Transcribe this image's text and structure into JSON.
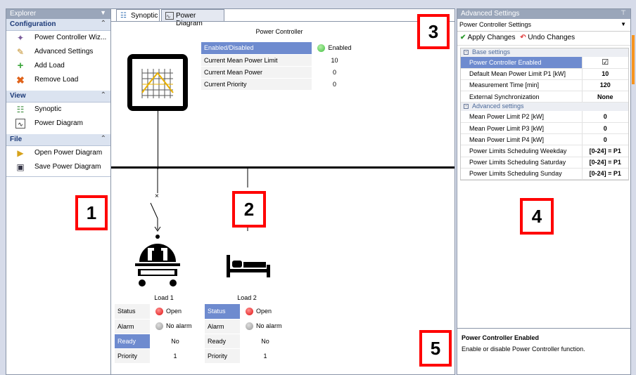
{
  "explorer": {
    "title": "Explorer",
    "sections": [
      {
        "label": "Configuration",
        "items": [
          {
            "label": "Power Controller Wiz...",
            "icon": "wand-icon"
          },
          {
            "label": "Advanced Settings",
            "icon": "edit-icon"
          },
          {
            "label": "Add Load",
            "icon": "add-icon"
          },
          {
            "label": "Remove Load",
            "icon": "remove-icon"
          }
        ]
      },
      {
        "label": "View",
        "items": [
          {
            "label": "Synoptic",
            "icon": "synoptic-icon"
          },
          {
            "label": "Power Diagram",
            "icon": "diagram-icon"
          }
        ]
      },
      {
        "label": "File",
        "items": [
          {
            "label": "Open Power Diagram",
            "icon": "open-folder-icon"
          },
          {
            "label": "Save Power Diagram",
            "icon": "save-icon"
          }
        ]
      }
    ]
  },
  "tabs": {
    "synoptic": "Synoptic",
    "power_diagram": "Power Diagram"
  },
  "controller": {
    "title": "Power Controller",
    "rows": [
      {
        "label": "Enabled/Disabled",
        "value": "Enabled"
      },
      {
        "label": "Current Mean Power Limit",
        "value": "10"
      },
      {
        "label": "Current Mean Power",
        "value": "0"
      },
      {
        "label": "Current Priority",
        "value": "0"
      }
    ]
  },
  "loads": [
    {
      "name": "Load 1",
      "rows": [
        {
          "label": "Status",
          "value": "Open"
        },
        {
          "label": "Alarm",
          "value": "No alarm"
        },
        {
          "label": "Ready",
          "value": "No"
        },
        {
          "label": "Priority",
          "value": "1"
        }
      ]
    },
    {
      "name": "Load 2",
      "rows": [
        {
          "label": "Status",
          "value": "Open"
        },
        {
          "label": "Alarm",
          "value": "No alarm"
        },
        {
          "label": "Ready",
          "value": "No"
        },
        {
          "label": "Priority",
          "value": "1"
        }
      ]
    }
  ],
  "advanced": {
    "title": "Advanced Settings",
    "dropdown_value": "Power Controller Settings",
    "apply_label": "Apply Changes",
    "undo_label": "Undo Changes",
    "base_title": "Base settings",
    "base_rows": [
      {
        "label": "Power Controller Enabled",
        "value": "☑"
      },
      {
        "label": "Default Mean Power Limit P1 [kW]",
        "value": "10"
      },
      {
        "label": "Measurement Time [min]",
        "value": "120"
      },
      {
        "label": "External Synchronization",
        "value": "None"
      }
    ],
    "adv_title": "Advanced settings",
    "adv_rows": [
      {
        "label": "Mean Power Limit P2 [kW]",
        "value": "0"
      },
      {
        "label": "Mean Power Limit P3 [kW]",
        "value": "0"
      },
      {
        "label": "Mean Power Limit P4 [kW]",
        "value": "0"
      },
      {
        "label": "Power Limits Scheduling Weekday",
        "value": "[0-24] = P1"
      },
      {
        "label": "Power Limits Scheduling Saturday",
        "value": "[0-24] = P1"
      },
      {
        "label": "Power Limits Scheduling Sunday",
        "value": "[0-24] = P1"
      }
    ],
    "desc_title": "Power Controller Enabled",
    "desc_text": "Enable or disable Power Controller function."
  },
  "callouts": [
    "1",
    "2",
    "3",
    "4",
    "5"
  ],
  "colors": {
    "selection": "#6e8bcf",
    "led_red": "#e01010",
    "led_green": "#3fbf3f",
    "led_gray": "#9a9a9a",
    "callout_border": "#ff0000"
  }
}
